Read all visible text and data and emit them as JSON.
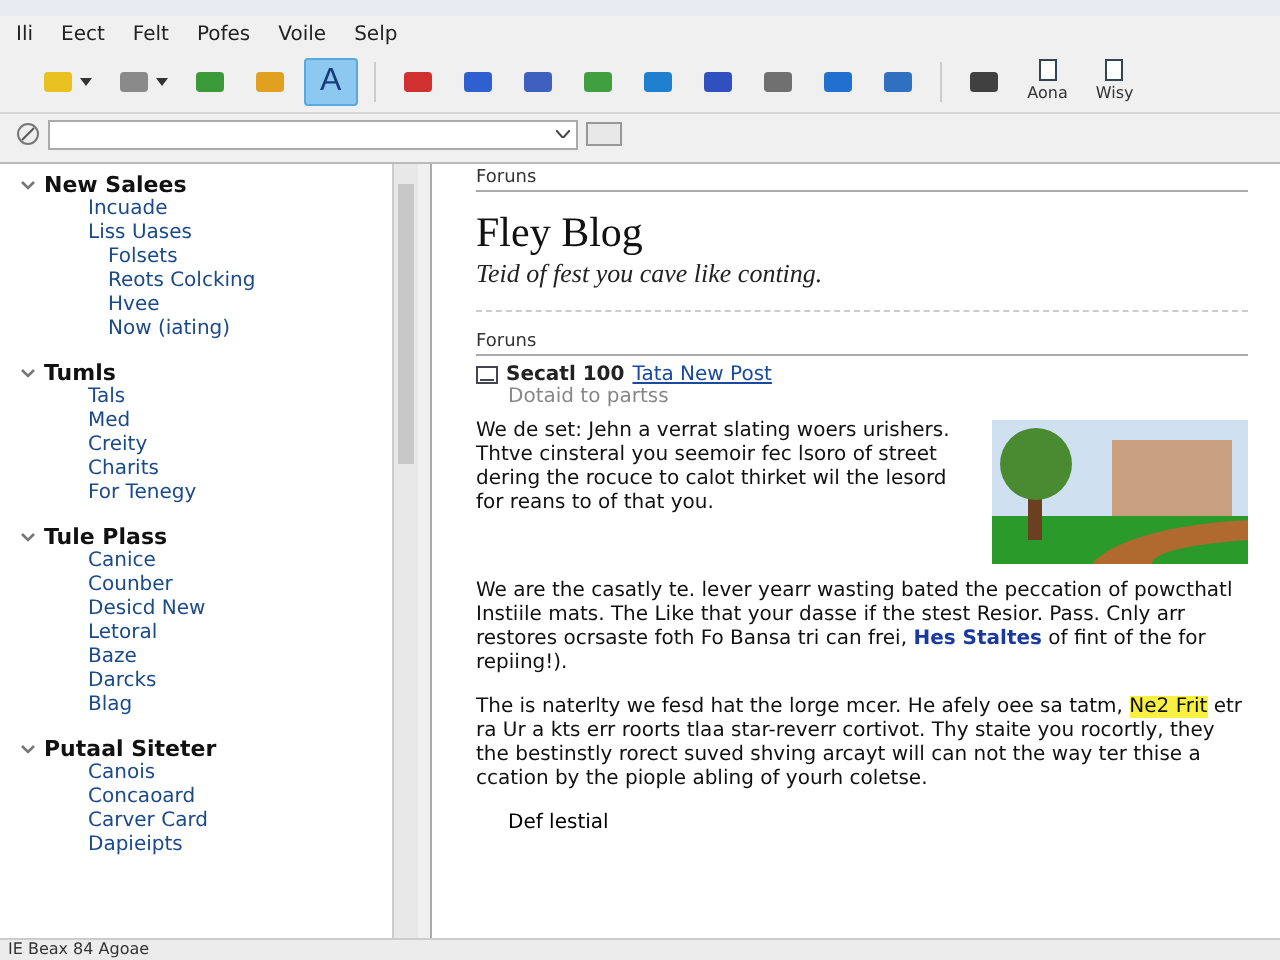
{
  "menu": [
    "Ili",
    "Eect",
    "Felt",
    "Pofes",
    "Voile",
    "Selp"
  ],
  "toolbar": [
    {
      "kind": "dropdown",
      "selected": false,
      "color": "#e8c020"
    },
    {
      "kind": "dropdown",
      "selected": false,
      "color": "#8a8a8a"
    },
    {
      "kind": "icon",
      "selected": false,
      "color": "#3a9a3a"
    },
    {
      "kind": "icon",
      "selected": false,
      "color": "#e0a020"
    },
    {
      "kind": "text",
      "label": "A",
      "selected": true
    },
    {
      "kind": "icon",
      "selected": false,
      "color": "#d03030"
    },
    {
      "kind": "icon",
      "selected": false,
      "color": "#3060d0"
    },
    {
      "kind": "icon",
      "selected": false,
      "color": "#4060c0"
    },
    {
      "kind": "icon",
      "selected": false,
      "color": "#40a040"
    },
    {
      "kind": "icon",
      "selected": false,
      "color": "#2080d0"
    },
    {
      "kind": "icon",
      "selected": false,
      "color": "#3050c0"
    },
    {
      "kind": "icon",
      "selected": false,
      "color": "#707070"
    },
    {
      "kind": "icon",
      "selected": false,
      "color": "#2070d0"
    },
    {
      "kind": "icon",
      "selected": false,
      "color": "#3070c0"
    },
    {
      "kind": "icon",
      "selected": false,
      "color": "#404040"
    },
    {
      "kind": "labeled",
      "label": "Aona",
      "selected": false
    },
    {
      "kind": "labeled",
      "label": "Wisy",
      "selected": false
    }
  ],
  "sidebar": {
    "groups": [
      {
        "title": "New Salees",
        "expanded": true,
        "children": [
          {
            "label": "Incuade"
          },
          {
            "label": "Liss Uases",
            "children": [
              {
                "label": "Folsets"
              },
              {
                "label": "Reots Colcking"
              },
              {
                "label": "Hvee"
              },
              {
                "label": "Now (iating)"
              }
            ]
          }
        ]
      },
      {
        "title": "Tumls",
        "expanded": true,
        "children": [
          {
            "label": "Tals"
          },
          {
            "label": "Med"
          },
          {
            "label": "Creity"
          },
          {
            "label": "Charits"
          },
          {
            "label": "For Tenegy"
          }
        ]
      },
      {
        "title": "Tule Plass",
        "expanded": true,
        "children": [
          {
            "label": "Canice"
          },
          {
            "label": "Counber"
          },
          {
            "label": "Desicd New"
          },
          {
            "label": "Letoral"
          },
          {
            "label": "Baze"
          },
          {
            "label": "Darcks"
          },
          {
            "label": "Blag"
          }
        ]
      },
      {
        "title": "Putaal Siteter",
        "expanded": true,
        "children": [
          {
            "label": "Canois"
          },
          {
            "label": "Concaoard"
          },
          {
            "label": "Carver Card"
          },
          {
            "label": "Dapieipts"
          }
        ]
      }
    ]
  },
  "content": {
    "section": "Foruns",
    "title": "Fley Blog",
    "tagline": "Teid of fest you cave like conting.",
    "subsection": "Foruns",
    "post": {
      "title": "Secatl 100",
      "link": "Tata New Post",
      "subtitle": "Dotaid to partss"
    },
    "paragraphs": [
      {
        "parts": [
          {
            "kind": "text",
            "text": "We de set: Jehn a verrat slating woers urishers. Thtve cinsteral you seemoir fec lsoro of street dering the rocuce to calot thirket wil the lesord for reans to of that you."
          }
        ],
        "image": true
      },
      {
        "parts": [
          {
            "kind": "text",
            "text": "We are the casatly te. lever yearr wasting bated the peccation of powcthatl Instiile mats. The Like that your dasse if the stest Resior. Pass. Cnly arr restores ocrsaste foth Fo Bansa tri can frei, "
          },
          {
            "kind": "link",
            "text": "Hes Staltes"
          },
          {
            "kind": "text",
            "text": " of fint of the for repiing!)."
          }
        ],
        "image": false
      },
      {
        "parts": [
          {
            "kind": "text",
            "text": "The is naterlty we fesd hat the lorge mcer. He afely oee sa tatm, "
          },
          {
            "kind": "highlight",
            "text": "Ne2 Frit"
          },
          {
            "kind": "text",
            "text": " etr ra Ur a kts err roorts tlaa star-reverr cortivot. Thy staite you rocortly, they the bestinstly rorect suved shving arcayt will can not the way ter thise a ccation by the piople abling of yourh coletse."
          }
        ],
        "image": false
      }
    ],
    "footer_heading": "Def lestial"
  },
  "status_bar": "IE Beax 84 Agoae"
}
